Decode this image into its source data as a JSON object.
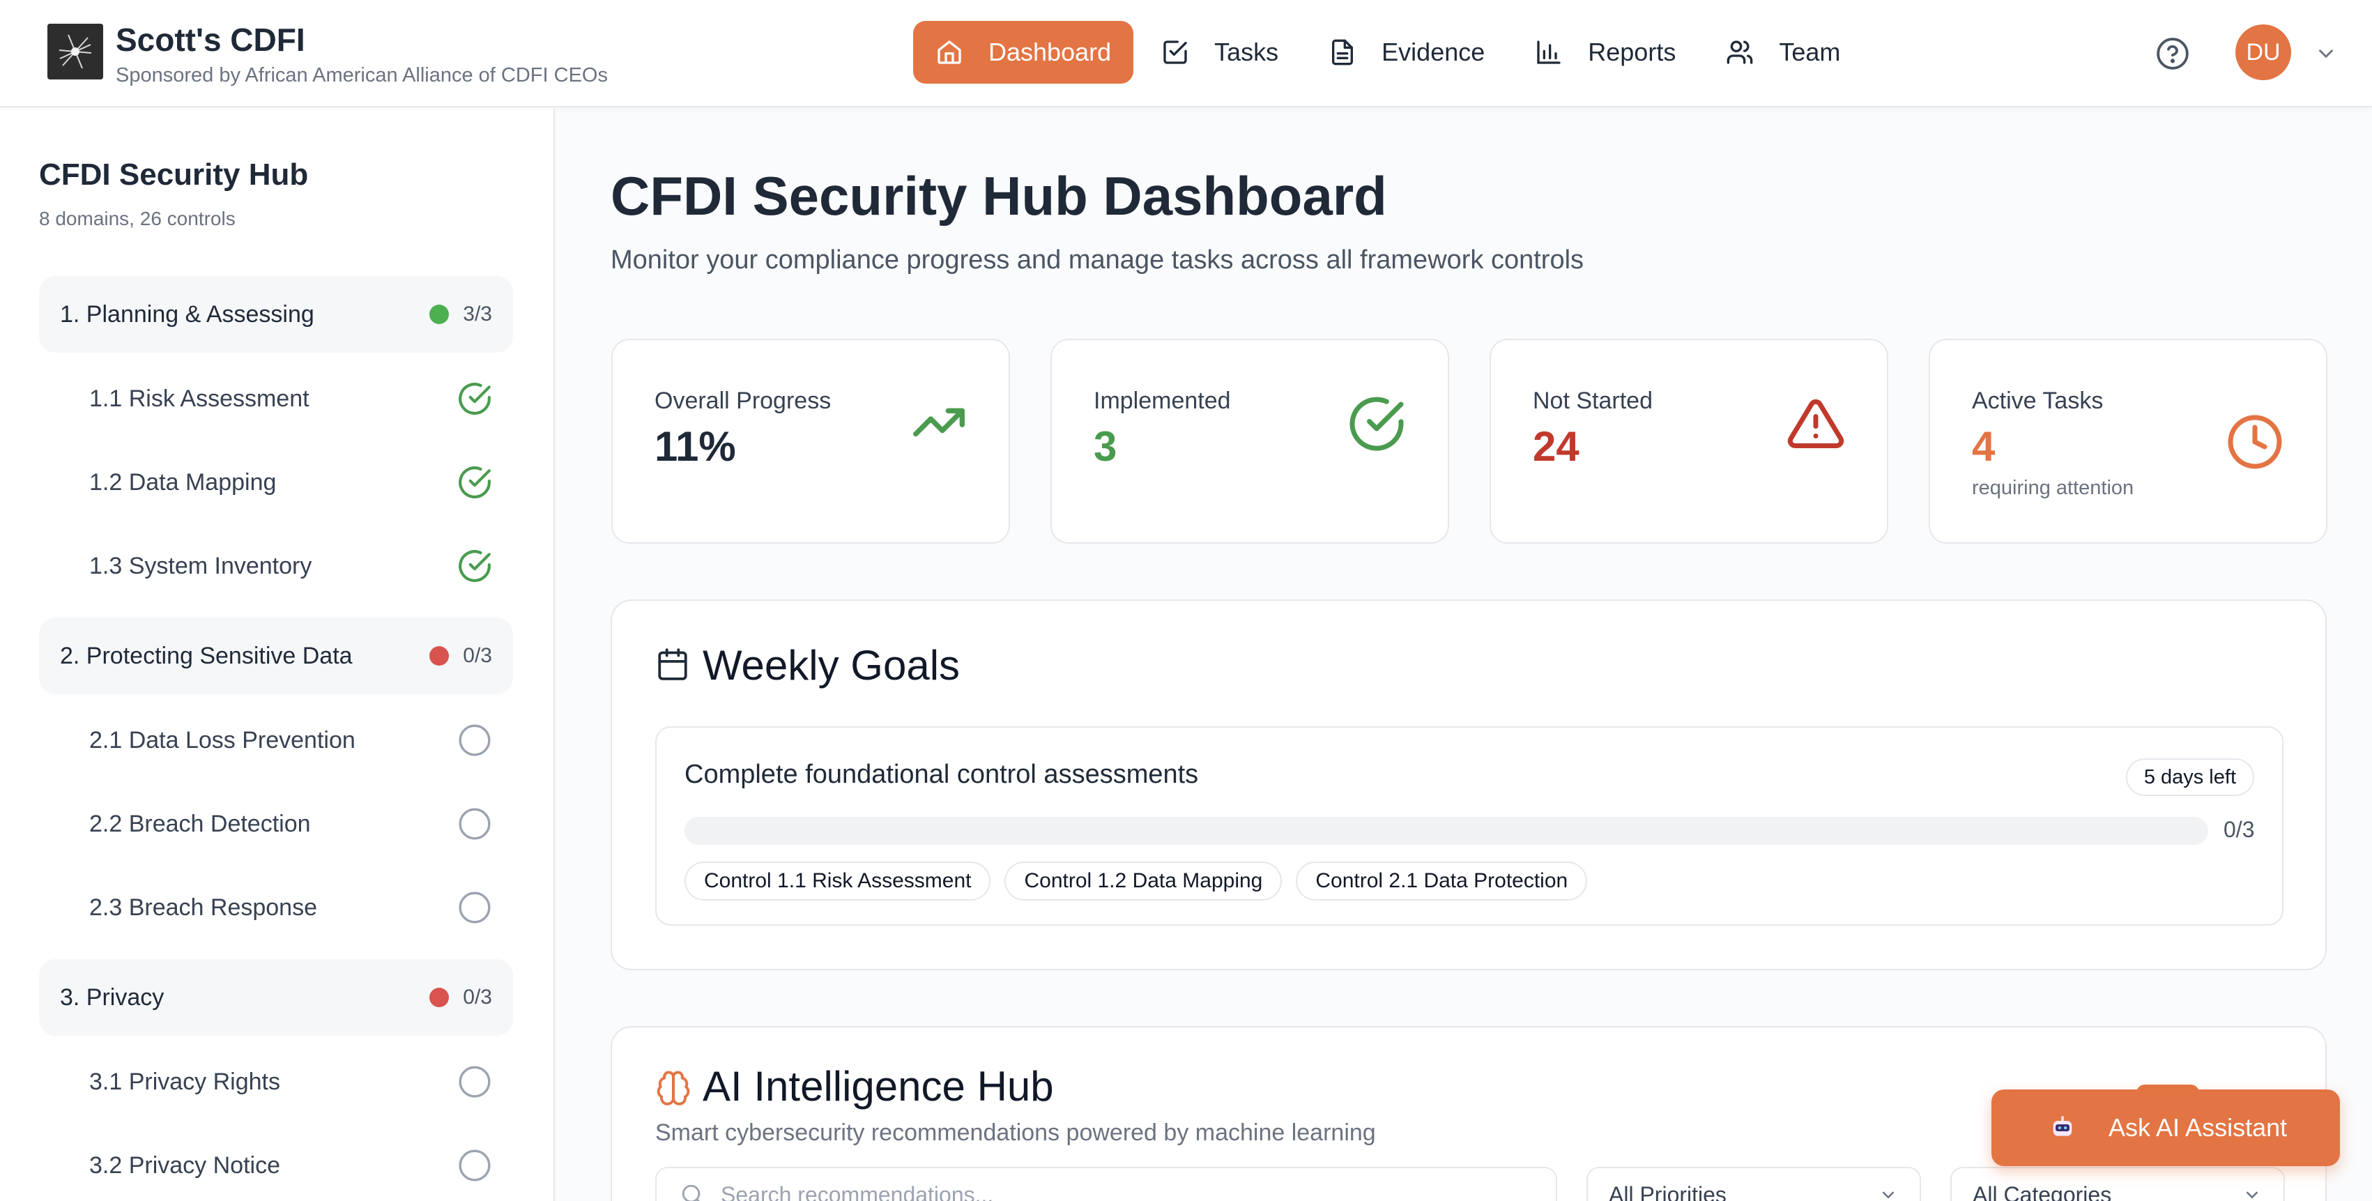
{
  "header": {
    "brand_title": "Scott's CDFI",
    "brand_subtitle": "Sponsored by African American Alliance of CDFI CEOs",
    "nav": [
      {
        "label": "Dashboard",
        "icon": "home-icon",
        "active": true
      },
      {
        "label": "Tasks",
        "icon": "checkbox-icon",
        "active": false
      },
      {
        "label": "Evidence",
        "icon": "document-icon",
        "active": false
      },
      {
        "label": "Reports",
        "icon": "bar-chart-icon",
        "active": false
      },
      {
        "label": "Team",
        "icon": "users-icon",
        "active": false
      }
    ],
    "avatar_initials": "DU"
  },
  "sidebar": {
    "title": "CFDI Security Hub",
    "subtitle": "8 domains, 26 controls",
    "domains": [
      {
        "label": "1. Planning & Assessing",
        "status_color": "#4caf50",
        "count": "3/3",
        "controls": [
          {
            "label": "1.1 Risk Assessment",
            "done": true
          },
          {
            "label": "1.2 Data Mapping",
            "done": true
          },
          {
            "label": "1.3 System Inventory",
            "done": true
          }
        ]
      },
      {
        "label": "2. Protecting Sensitive Data",
        "status_color": "#d9534f",
        "count": "0/3",
        "controls": [
          {
            "label": "2.1 Data Loss Prevention",
            "done": false
          },
          {
            "label": "2.2 Breach Detection",
            "done": false
          },
          {
            "label": "2.3 Breach Response",
            "done": false
          }
        ]
      },
      {
        "label": "3. Privacy",
        "status_color": "#d9534f",
        "count": "0/3",
        "controls": [
          {
            "label": "3.1 Privacy Rights",
            "done": false
          },
          {
            "label": "3.2 Privacy Notice",
            "done": false
          }
        ]
      }
    ]
  },
  "main": {
    "title": "CFDI Security Hub Dashboard",
    "subtitle": "Monitor your compliance progress and manage tasks across all framework controls",
    "stats": [
      {
        "label": "Overall Progress",
        "value": "11%",
        "note": "",
        "value_color": "#1f2937",
        "icon": "trending-up-icon",
        "icon_color": "#4a9b4f"
      },
      {
        "label": "Implemented",
        "value": "3",
        "note": "",
        "value_color": "#4a9b4f",
        "icon": "check-circle-icon",
        "icon_color": "#4a9b4f"
      },
      {
        "label": "Not Started",
        "value": "24",
        "note": "",
        "value_color": "#c0392b",
        "icon": "alert-triangle-icon",
        "icon_color": "#c0392b"
      },
      {
        "label": "Active Tasks",
        "value": "4",
        "note": "requiring attention",
        "value_color": "#e37443",
        "icon": "clock-icon",
        "icon_color": "#e37443"
      }
    ],
    "weekly_goals": {
      "title": "Weekly Goals",
      "goal": {
        "title": "Complete foundational control assessments",
        "badge": "5 days left",
        "progress": 0,
        "count": "0/3",
        "tags": [
          "Control 1.1 Risk Assessment",
          "Control 1.2 Data Mapping",
          "Control 2.1 Data Protection"
        ]
      }
    },
    "ai_hub": {
      "title": "AI Intelligence Hub",
      "subtitle": "Smart cybersecurity recommendations powered by machine learning",
      "search_placeholder": "Search recommendations...",
      "priority_select": "All Priorities",
      "category_select": "All Categories"
    },
    "ask_button": "Ask AI Assistant"
  },
  "colors": {
    "accent": "#e37443",
    "success": "#4a9b4f",
    "danger": "#c0392b"
  }
}
